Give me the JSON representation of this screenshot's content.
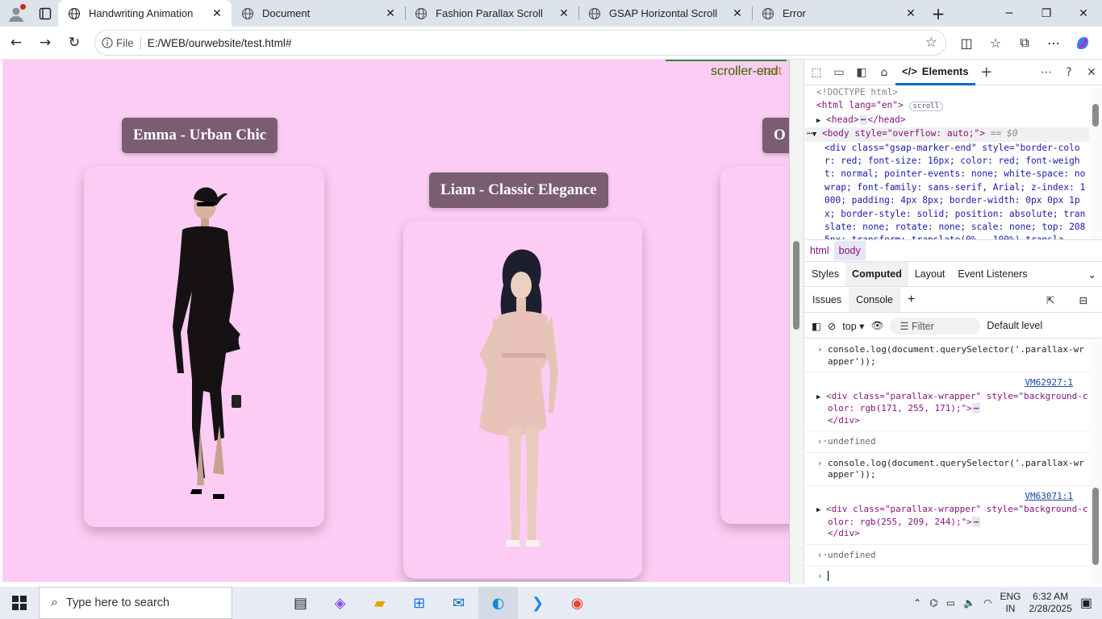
{
  "tabs": [
    {
      "title": "Handwriting Animation",
      "active": true
    },
    {
      "title": "Document",
      "active": false
    },
    {
      "title": "Fashion Parallax Scroll",
      "active": false
    },
    {
      "title": "GSAP Horizontal Scroll",
      "active": false
    },
    {
      "title": "Error",
      "active": false
    }
  ],
  "address": {
    "badge": "File",
    "url": "E:/WEB/ourwebsite/test.html#"
  },
  "page": {
    "marker_end": "scroller-end",
    "marker_start": "scroller-start",
    "cards": [
      {
        "name": "Emma - Urban Chic",
        "dress_color": "#161214"
      },
      {
        "name": "Liam - Classic Elegance",
        "dress_color": "#e9c3ba"
      },
      {
        "name": "O"
      }
    ]
  },
  "devtools": {
    "elements_tab": "Elements",
    "dom": {
      "doctype": "<!DOCTYPE html>",
      "html_open": "<html lang=\"en\">",
      "scroll_badge": "scroll",
      "head": "<head>",
      "head_close": "</head>",
      "body_tag": "<body style=\"overflow: auto;\">",
      "body_eq": "== $0",
      "div_line": "<div class=\"gsap-marker-end\" style=\"border-color: red; font-size: 16px; color: red; font-weight: normal; pointer-events: none; white-space: nowrap; font-family: sans-serif, Arial; z-index: 1000; padding: 4px 8px; border-width: 0px 0px 1px; border-style: solid; position: absolute; translate: none; rotate: none; scale: none; top: 2085px; transform: translate(0%, -100%) transla"
    },
    "breadcrumb": [
      "html",
      "body"
    ],
    "panel_tabs": [
      "Styles",
      "Computed",
      "Layout",
      "Event Listeners"
    ],
    "drawer_tabs": [
      "Issues",
      "Console"
    ],
    "console_toolbar": {
      "context": "top",
      "filter_placeholder": "Filter",
      "levels": "Default level"
    },
    "console_entries": [
      {
        "type": "input",
        "text": "console.log(document.querySelector('.parallax-wrapper'));"
      },
      {
        "type": "log",
        "source": "VM62927:1",
        "text": "<div class=\"parallax-wrapper\" style=\"background-color: rgb(171, 255, 171);\">",
        "close": "</div>"
      },
      {
        "type": "result",
        "text": "undefined"
      },
      {
        "type": "input",
        "text": "console.log(document.querySelector('.parallax-wrapper'));"
      },
      {
        "type": "log",
        "source": "VM63071:1",
        "text": "<div class=\"parallax-wrapper\" style=\"background-color: rgb(255, 209, 244);\">",
        "close": "</div>"
      },
      {
        "type": "result",
        "text": "undefined"
      }
    ]
  },
  "taskbar": {
    "search_placeholder": "Type here to search",
    "lang": "ENG",
    "region": "IN",
    "time": "6:32 AM",
    "date": "2/28/2025"
  }
}
